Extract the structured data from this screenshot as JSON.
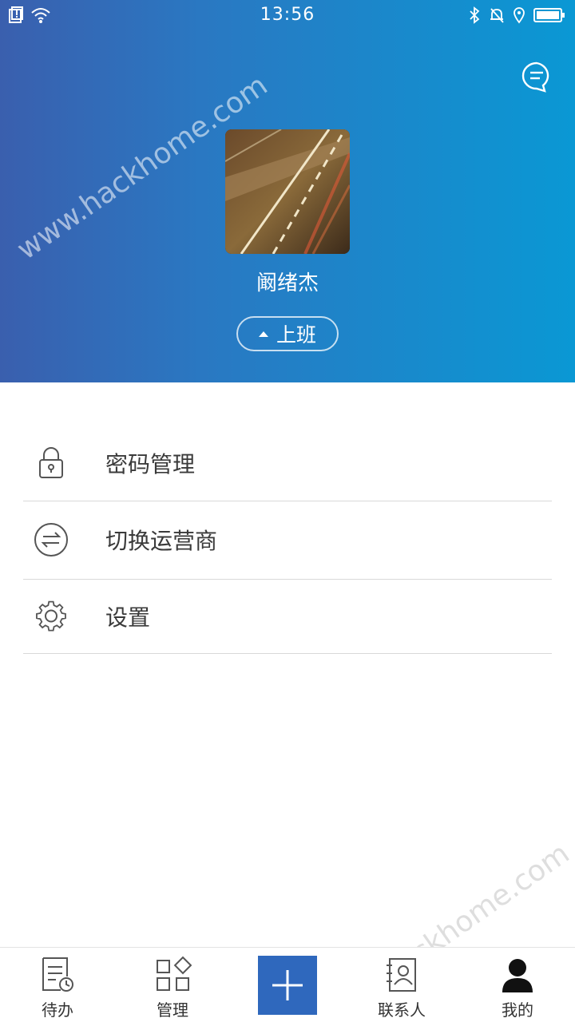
{
  "status_bar": {
    "time": "13:56"
  },
  "profile": {
    "name": "阚绪杰",
    "status_label": "上班"
  },
  "menu": [
    {
      "label": "密码管理",
      "icon": "lock-icon"
    },
    {
      "label": "切换运营商",
      "icon": "switch-icon"
    },
    {
      "label": "设置",
      "icon": "gear-icon"
    }
  ],
  "tabs": [
    {
      "label": "待办",
      "icon": "todo-icon"
    },
    {
      "label": "管理",
      "icon": "grid-icon"
    },
    {
      "label": "联系人",
      "icon": "contacts-icon"
    },
    {
      "label": "我的",
      "icon": "person-icon"
    }
  ],
  "watermark": "www.hackhome.com",
  "colors": {
    "header_start": "#3a5fae",
    "header_end": "#0a98d4",
    "accent": "#2f68bd"
  }
}
